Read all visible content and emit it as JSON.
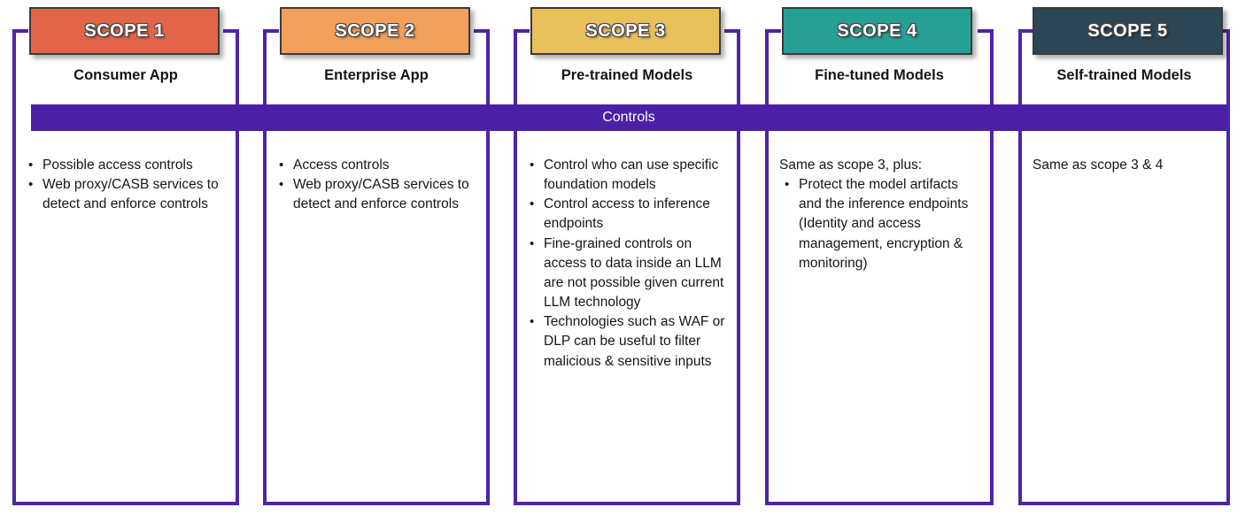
{
  "diagram": {
    "band": {
      "label": "Controls",
      "color": "#4A21A6"
    },
    "frame_color": "#5024A8",
    "columns": [
      {
        "badge_label": "SCOPE 1",
        "badge_color": "#E2654A",
        "subtitle": "Consumer App",
        "lead": "",
        "bullets": [
          "Possible access controls",
          "Web proxy/CASB services to detect and enforce controls"
        ]
      },
      {
        "badge_label": "SCOPE 2",
        "badge_color": "#F0A05A",
        "subtitle": "Enterprise App",
        "lead": "",
        "bullets": [
          "Access controls",
          "Web proxy/CASB services to detect and enforce controls"
        ]
      },
      {
        "badge_label": "SCOPE 3",
        "badge_color": "#E8C05C",
        "subtitle": "Pre-trained Models",
        "lead": "",
        "bullets": [
          "Control who can use specific foundation models",
          "Control access to inference endpoints",
          "Fine-grained controls on access to data inside an LLM are not possible given current LLM technology",
          "Technologies such as WAF or DLP can be useful to filter malicious & sensitive inputs"
        ]
      },
      {
        "badge_label": "SCOPE 4",
        "badge_color": "#27A094",
        "subtitle": "Fine-tuned Models",
        "lead": "Same as scope 3, plus:",
        "bullets": [
          "Protect the model artifacts and the inference endpoints (Identity and access management, encryption & monitoring)"
        ]
      },
      {
        "badge_label": "SCOPE 5",
        "badge_color": "#2D4654",
        "subtitle": "Self-trained Models",
        "lead": "Same as scope 3 & 4",
        "bullets": []
      }
    ]
  }
}
